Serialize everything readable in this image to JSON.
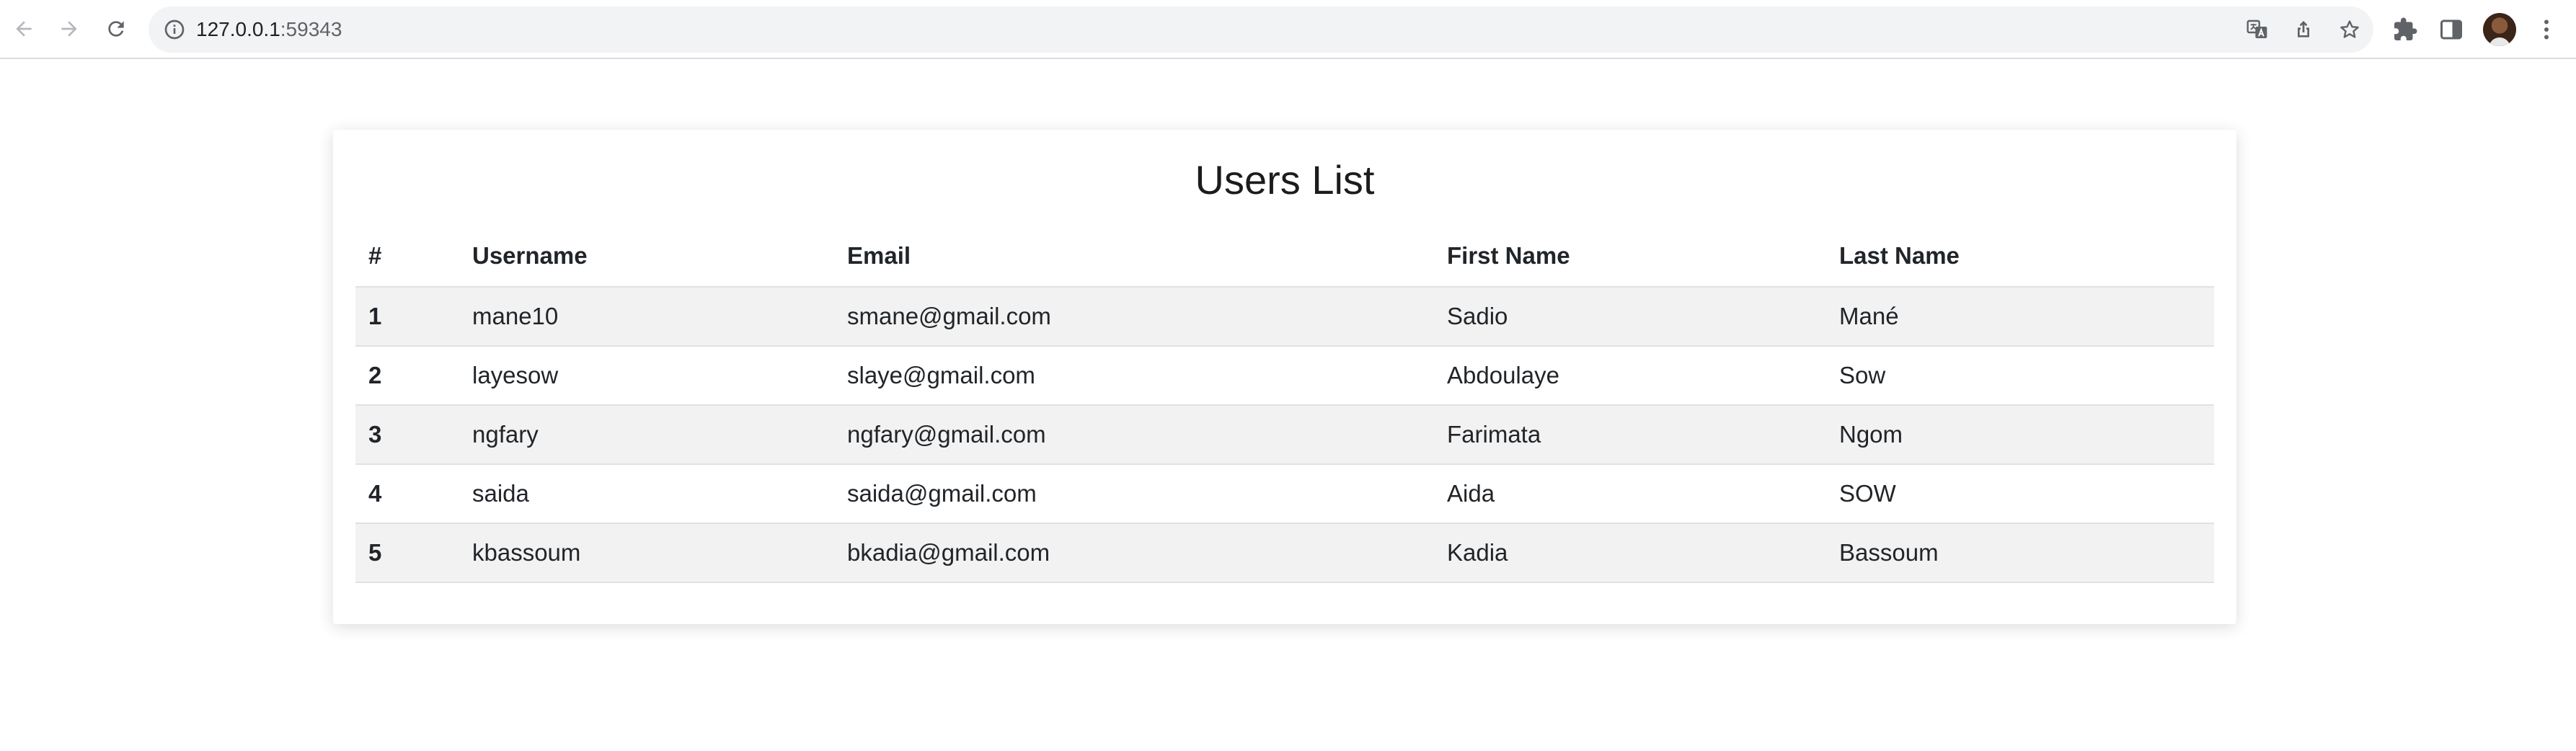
{
  "browser": {
    "url_host": "127.0.0.1",
    "url_port": ":59343",
    "icons": {
      "back": "back-arrow-icon",
      "forward": "forward-arrow-icon",
      "reload": "reload-icon",
      "info": "info-icon",
      "translate": "translate-icon",
      "share": "share-icon",
      "bookmark": "star-icon",
      "extensions": "puzzle-icon",
      "side_panel": "side-panel-icon",
      "profile": "avatar",
      "menu": "kebab-menu-icon"
    }
  },
  "page": {
    "title": "Users List",
    "table": {
      "headers": [
        "#",
        "Username",
        "Email",
        "First Name",
        "Last Name"
      ],
      "rows": [
        {
          "idx": "1",
          "username": "mane10",
          "email": "smane@gmail.com",
          "first_name": "Sadio",
          "last_name": "Mané"
        },
        {
          "idx": "2",
          "username": "layesow",
          "email": "slaye@gmail.com",
          "first_name": "Abdoulaye",
          "last_name": "Sow"
        },
        {
          "idx": "3",
          "username": "ngfary",
          "email": "ngfary@gmail.com",
          "first_name": "Farimata",
          "last_name": "Ngom"
        },
        {
          "idx": "4",
          "username": "saida",
          "email": "saida@gmail.com",
          "first_name": "Aida",
          "last_name": "SOW"
        },
        {
          "idx": "5",
          "username": "kbassoum",
          "email": "bkadia@gmail.com",
          "first_name": "Kadia",
          "last_name": "Bassoum"
        }
      ]
    }
  },
  "colors": {
    "stripe": "#f2f2f2",
    "border": "#dee2e6",
    "text": "#212529",
    "omnibox": "#f1f3f4"
  }
}
